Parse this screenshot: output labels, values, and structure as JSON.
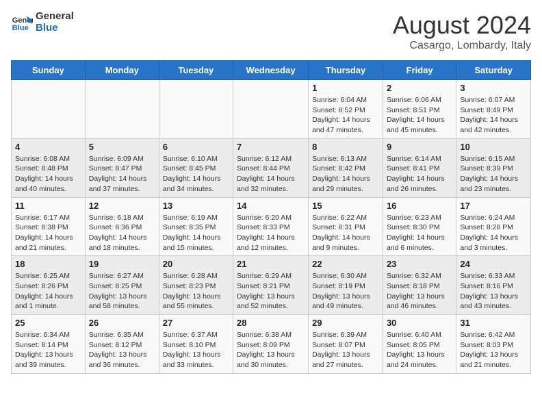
{
  "header": {
    "logo_line1": "General",
    "logo_line2": "Blue",
    "title": "August 2024",
    "subtitle": "Casargo, Lombardy, Italy"
  },
  "days_of_week": [
    "Sunday",
    "Monday",
    "Tuesday",
    "Wednesday",
    "Thursday",
    "Friday",
    "Saturday"
  ],
  "weeks": [
    [
      {
        "day": "",
        "info": ""
      },
      {
        "day": "",
        "info": ""
      },
      {
        "day": "",
        "info": ""
      },
      {
        "day": "",
        "info": ""
      },
      {
        "day": "1",
        "info": "Sunrise: 6:04 AM\nSunset: 8:52 PM\nDaylight: 14 hours and 47 minutes."
      },
      {
        "day": "2",
        "info": "Sunrise: 6:06 AM\nSunset: 8:51 PM\nDaylight: 14 hours and 45 minutes."
      },
      {
        "day": "3",
        "info": "Sunrise: 6:07 AM\nSunset: 8:49 PM\nDaylight: 14 hours and 42 minutes."
      }
    ],
    [
      {
        "day": "4",
        "info": "Sunrise: 6:08 AM\nSunset: 8:48 PM\nDaylight: 14 hours and 40 minutes."
      },
      {
        "day": "5",
        "info": "Sunrise: 6:09 AM\nSunset: 8:47 PM\nDaylight: 14 hours and 37 minutes."
      },
      {
        "day": "6",
        "info": "Sunrise: 6:10 AM\nSunset: 8:45 PM\nDaylight: 14 hours and 34 minutes."
      },
      {
        "day": "7",
        "info": "Sunrise: 6:12 AM\nSunset: 8:44 PM\nDaylight: 14 hours and 32 minutes."
      },
      {
        "day": "8",
        "info": "Sunrise: 6:13 AM\nSunset: 8:42 PM\nDaylight: 14 hours and 29 minutes."
      },
      {
        "day": "9",
        "info": "Sunrise: 6:14 AM\nSunset: 8:41 PM\nDaylight: 14 hours and 26 minutes."
      },
      {
        "day": "10",
        "info": "Sunrise: 6:15 AM\nSunset: 8:39 PM\nDaylight: 14 hours and 23 minutes."
      }
    ],
    [
      {
        "day": "11",
        "info": "Sunrise: 6:17 AM\nSunset: 8:38 PM\nDaylight: 14 hours and 21 minutes."
      },
      {
        "day": "12",
        "info": "Sunrise: 6:18 AM\nSunset: 8:36 PM\nDaylight: 14 hours and 18 minutes."
      },
      {
        "day": "13",
        "info": "Sunrise: 6:19 AM\nSunset: 8:35 PM\nDaylight: 14 hours and 15 minutes."
      },
      {
        "day": "14",
        "info": "Sunrise: 6:20 AM\nSunset: 8:33 PM\nDaylight: 14 hours and 12 minutes."
      },
      {
        "day": "15",
        "info": "Sunrise: 6:22 AM\nSunset: 8:31 PM\nDaylight: 14 hours and 9 minutes."
      },
      {
        "day": "16",
        "info": "Sunrise: 6:23 AM\nSunset: 8:30 PM\nDaylight: 14 hours and 6 minutes."
      },
      {
        "day": "17",
        "info": "Sunrise: 6:24 AM\nSunset: 8:28 PM\nDaylight: 14 hours and 3 minutes."
      }
    ],
    [
      {
        "day": "18",
        "info": "Sunrise: 6:25 AM\nSunset: 8:26 PM\nDaylight: 14 hours and 1 minute."
      },
      {
        "day": "19",
        "info": "Sunrise: 6:27 AM\nSunset: 8:25 PM\nDaylight: 13 hours and 58 minutes."
      },
      {
        "day": "20",
        "info": "Sunrise: 6:28 AM\nSunset: 8:23 PM\nDaylight: 13 hours and 55 minutes."
      },
      {
        "day": "21",
        "info": "Sunrise: 6:29 AM\nSunset: 8:21 PM\nDaylight: 13 hours and 52 minutes."
      },
      {
        "day": "22",
        "info": "Sunrise: 6:30 AM\nSunset: 8:19 PM\nDaylight: 13 hours and 49 minutes."
      },
      {
        "day": "23",
        "info": "Sunrise: 6:32 AM\nSunset: 8:18 PM\nDaylight: 13 hours and 46 minutes."
      },
      {
        "day": "24",
        "info": "Sunrise: 6:33 AM\nSunset: 8:16 PM\nDaylight: 13 hours and 43 minutes."
      }
    ],
    [
      {
        "day": "25",
        "info": "Sunrise: 6:34 AM\nSunset: 8:14 PM\nDaylight: 13 hours and 39 minutes."
      },
      {
        "day": "26",
        "info": "Sunrise: 6:35 AM\nSunset: 8:12 PM\nDaylight: 13 hours and 36 minutes."
      },
      {
        "day": "27",
        "info": "Sunrise: 6:37 AM\nSunset: 8:10 PM\nDaylight: 13 hours and 33 minutes."
      },
      {
        "day": "28",
        "info": "Sunrise: 6:38 AM\nSunset: 8:09 PM\nDaylight: 13 hours and 30 minutes."
      },
      {
        "day": "29",
        "info": "Sunrise: 6:39 AM\nSunset: 8:07 PM\nDaylight: 13 hours and 27 minutes."
      },
      {
        "day": "30",
        "info": "Sunrise: 6:40 AM\nSunset: 8:05 PM\nDaylight: 13 hours and 24 minutes."
      },
      {
        "day": "31",
        "info": "Sunrise: 6:42 AM\nSunset: 8:03 PM\nDaylight: 13 hours and 21 minutes."
      }
    ]
  ]
}
